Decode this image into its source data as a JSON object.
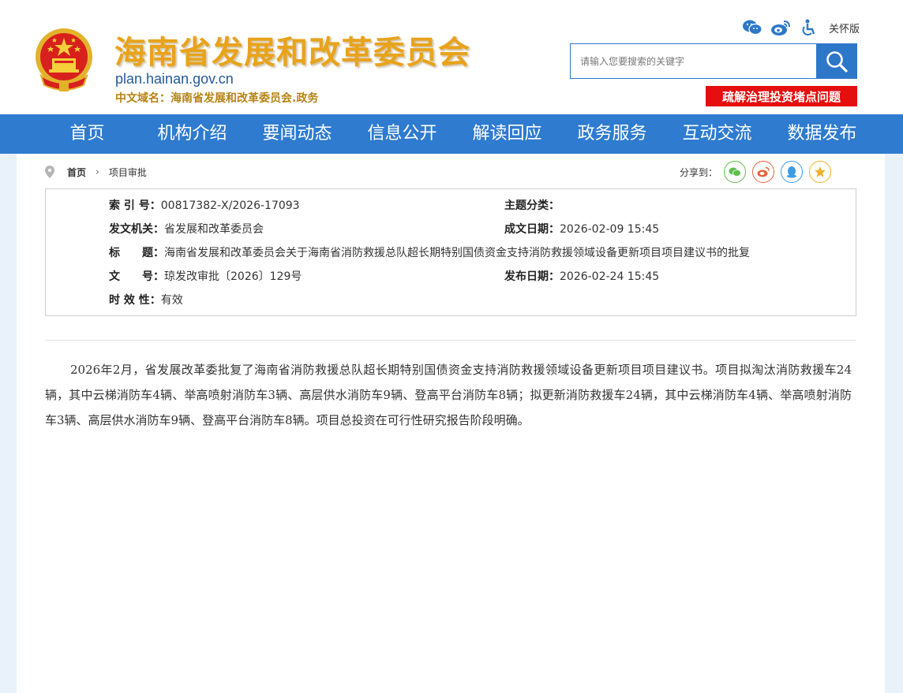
{
  "header": {
    "site_title": "海南省发展和改革委员会",
    "domain": "plan.hainan.gov.cn",
    "cn_domain": "中文域名：海南省发展和改革委员会.政务",
    "care_mode": "关怀版",
    "search_placeholder": "请输入您要搜索的关键字",
    "issue_banner": "疏解治理投资堵点问题",
    "icons": [
      "wechat-icon",
      "weibo-icon",
      "accessibility-icon",
      "search-icon"
    ]
  },
  "nav": {
    "items": [
      "首页",
      "机构介绍",
      "要闻动态",
      "信息公开",
      "解读回应",
      "政务服务",
      "互动交流",
      "数据发布"
    ]
  },
  "breadcrumb": {
    "home": "首页",
    "current": "项目审批"
  },
  "share": {
    "label": "分享到：",
    "targets": [
      "wechat",
      "weibo",
      "qq",
      "qzone"
    ]
  },
  "meta": {
    "index_label": "索 引 号：",
    "index_value": "00817382-X/2026-17093",
    "topic_label": "主题分类：",
    "topic_value": "",
    "issuer_label": "发文机关：",
    "issuer_value": "省发展和改革委员会",
    "date_made_label": "成文日期：",
    "date_made_value": "2026-02-09 15:45",
    "title_label": "标　　题：",
    "title_value": "海南省发展和改革委员会关于海南省消防救援总队超长期特别国债资金支持消防救援领域设备更新项目项目建议书的批复",
    "docno_label": "文　　号：",
    "docno_value": "琼发改审批〔2026〕129号",
    "pub_date_label": "发布日期：",
    "pub_date_value": "2026-02-24 15:45",
    "validity_label": "时 效 性：",
    "validity_value": "有效"
  },
  "article": {
    "body": "2026年2月，省发展改革委批复了海南省消防救援总队超长期特别国债资金支持消防救援领域设备更新项目项目建议书。项目拟淘汰消防救援车24辆，其中云梯消防车4辆、举高喷射消防车3辆、高层供水消防车9辆、登高平台消防车8辆；拟更新消防救援车24辆，其中云梯消防车4辆、举高喷射消防车3辆、高层供水消防车9辆、登高平台消防车8辆。项目总投资在可行性研究报告阶段明确。"
  },
  "colors": {
    "nav_bg": "#2e7bd0",
    "title_gold": "#e8a31b",
    "banner_red": "#e50f0f",
    "page_bg": "#e9f2fa"
  }
}
